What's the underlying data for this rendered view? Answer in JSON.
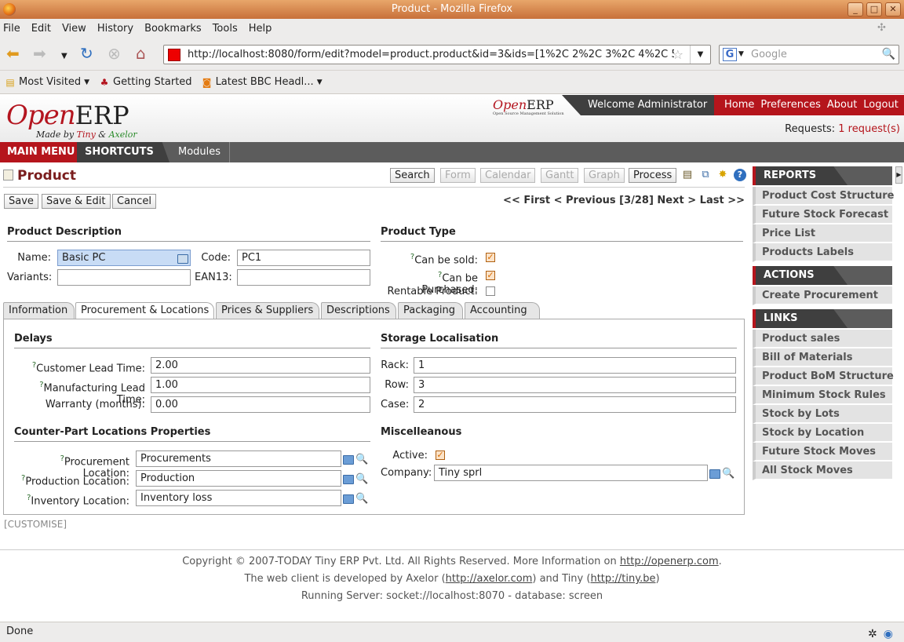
{
  "window": {
    "title": "Product - Mozilla Firefox"
  },
  "menu": [
    "File",
    "Edit",
    "View",
    "History",
    "Bookmarks",
    "Tools",
    "Help"
  ],
  "url": "http://localhost:8080/form/edit?model=product.product&id=3&ids=[1%2C 2%2C 3%2C 4%2C 5%",
  "search": {
    "placeholder": "Google"
  },
  "bookmarks": [
    "Most Visited",
    "Getting Started",
    "Latest BBC Headl..."
  ],
  "header": {
    "welcome": "Welcome Administrator",
    "links": [
      "Home",
      "Preferences",
      "About",
      "Logout"
    ],
    "requests_label": "Requests:",
    "requests_value": "1 request(s)",
    "logo_open": "Open",
    "logo_erp": "ERP",
    "made_by": "Made by",
    "tiny": "Tiny",
    "amp": "&",
    "axelor": "Axelor",
    "mini_tag": "Open Source Management Solution"
  },
  "mainmenu": {
    "main": "MAIN MENU",
    "shortcuts": "SHORTCUTS",
    "modules": "Modules"
  },
  "page": {
    "title": "Product",
    "views": [
      "Search",
      "Form",
      "Calendar",
      "Gantt",
      "Graph",
      "Process"
    ],
    "actions": [
      "Save",
      "Save & Edit",
      "Cancel"
    ],
    "pager": "<< First < Previous [3/28] Next > Last >>",
    "customise": "[CUSTOMISE]"
  },
  "form": {
    "desc_title": "Product Description",
    "type_title": "Product Type",
    "name_label": "Name:",
    "name_value": "Basic PC",
    "code_label": "Code:",
    "code_value": "PC1",
    "variants_label": "Variants:",
    "variants_value": "",
    "ean_label": "EAN13:",
    "ean_value": "",
    "sold_label": "Can be sold:",
    "sold": true,
    "purch_label": "Can be Purchased:",
    "purch": true,
    "rent_label": "Rentable Product:",
    "rent": false
  },
  "tabs": [
    "Information",
    "Procurement & Locations",
    "Prices & Suppliers",
    "Descriptions",
    "Packaging",
    "Accounting"
  ],
  "procurement": {
    "delays_title": "Delays",
    "storage_title": "Storage Localisation",
    "cust_lead_label": "Customer Lead Time:",
    "cust_lead": "2.00",
    "manuf_lead_label": "Manufacturing Lead Time:",
    "manuf_lead": "1.00",
    "warranty_label": "Warranty (months):",
    "warranty": "0.00",
    "rack_label": "Rack:",
    "rack": "1",
    "row_label": "Row:",
    "row": "3",
    "case_label": "Case:",
    "case": "2",
    "counter_title": "Counter-Part Locations Properties",
    "misc_title": "Miscelleanous",
    "proc_loc_label": "Procurement Location:",
    "proc_loc": "Procurements",
    "prod_loc_label": "Production Location:",
    "prod_loc": "Production",
    "inv_loc_label": "Inventory Location:",
    "inv_loc": "Inventory loss",
    "active_label": "Active:",
    "active": true,
    "company_label": "Company:",
    "company": "Tiny sprl"
  },
  "sidebar": {
    "reports_title": "REPORTS",
    "reports": [
      "Product Cost Structure",
      "Future Stock Forecast",
      "Price List",
      "Products Labels"
    ],
    "actions_title": "ACTIONS",
    "actions": [
      "Create Procurement"
    ],
    "links_title": "LINKS",
    "links": [
      "Product sales",
      "Bill of Materials",
      "Product BoM Structure",
      "Minimum Stock Rules",
      "Stock by Lots",
      "Stock by Location",
      "Future Stock Moves",
      "All Stock Moves"
    ]
  },
  "footer": {
    "line1_pre": "Copyright © 2007-TODAY Tiny ERP Pvt. Ltd. All Rights Reserved. More Information on ",
    "line1_link": "http://openerp.com",
    "line1_post": ".",
    "line2_pre": "The web client is developed by Axelor (",
    "line2_link1": "http://axelor.com",
    "line2_mid": ") and Tiny (",
    "line2_link2": "http://tiny.be",
    "line2_post": ")",
    "line3": "Running Server: socket://localhost:8070 - database: screen"
  },
  "status": "Done"
}
